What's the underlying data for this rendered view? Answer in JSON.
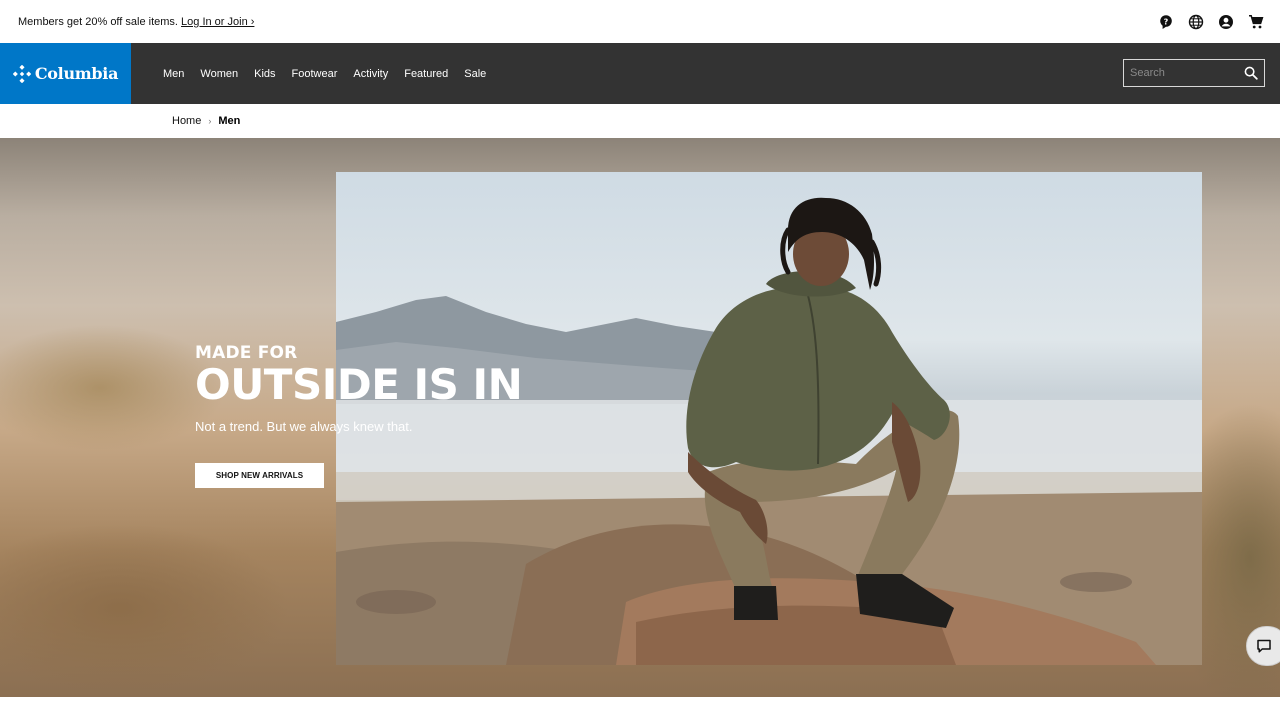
{
  "promo": {
    "text": "Members get 20% off sale items.",
    "link": "Log In or Join ›"
  },
  "utility_icons": [
    "help-icon",
    "globe-icon",
    "account-icon",
    "cart-icon"
  ],
  "brand": {
    "name": "Columbia",
    "color": "#0077c8"
  },
  "nav": {
    "items": [
      {
        "label": "Men"
      },
      {
        "label": "Women"
      },
      {
        "label": "Kids"
      },
      {
        "label": "Footwear"
      },
      {
        "label": "Activity"
      },
      {
        "label": "Featured"
      },
      {
        "label": "Sale"
      }
    ],
    "background": "#333333"
  },
  "search": {
    "placeholder": "Search",
    "value": ""
  },
  "breadcrumb": {
    "home": "Home",
    "separator": "›",
    "current": "Men"
  },
  "hero": {
    "eyebrow": "MADE FOR",
    "title": "OUTSIDE IS IN",
    "subtitle": "Not a trend. But we always knew that.",
    "cta": "SHOP NEW ARRIVALS"
  },
  "chat": {
    "icon": "chat-icon"
  }
}
